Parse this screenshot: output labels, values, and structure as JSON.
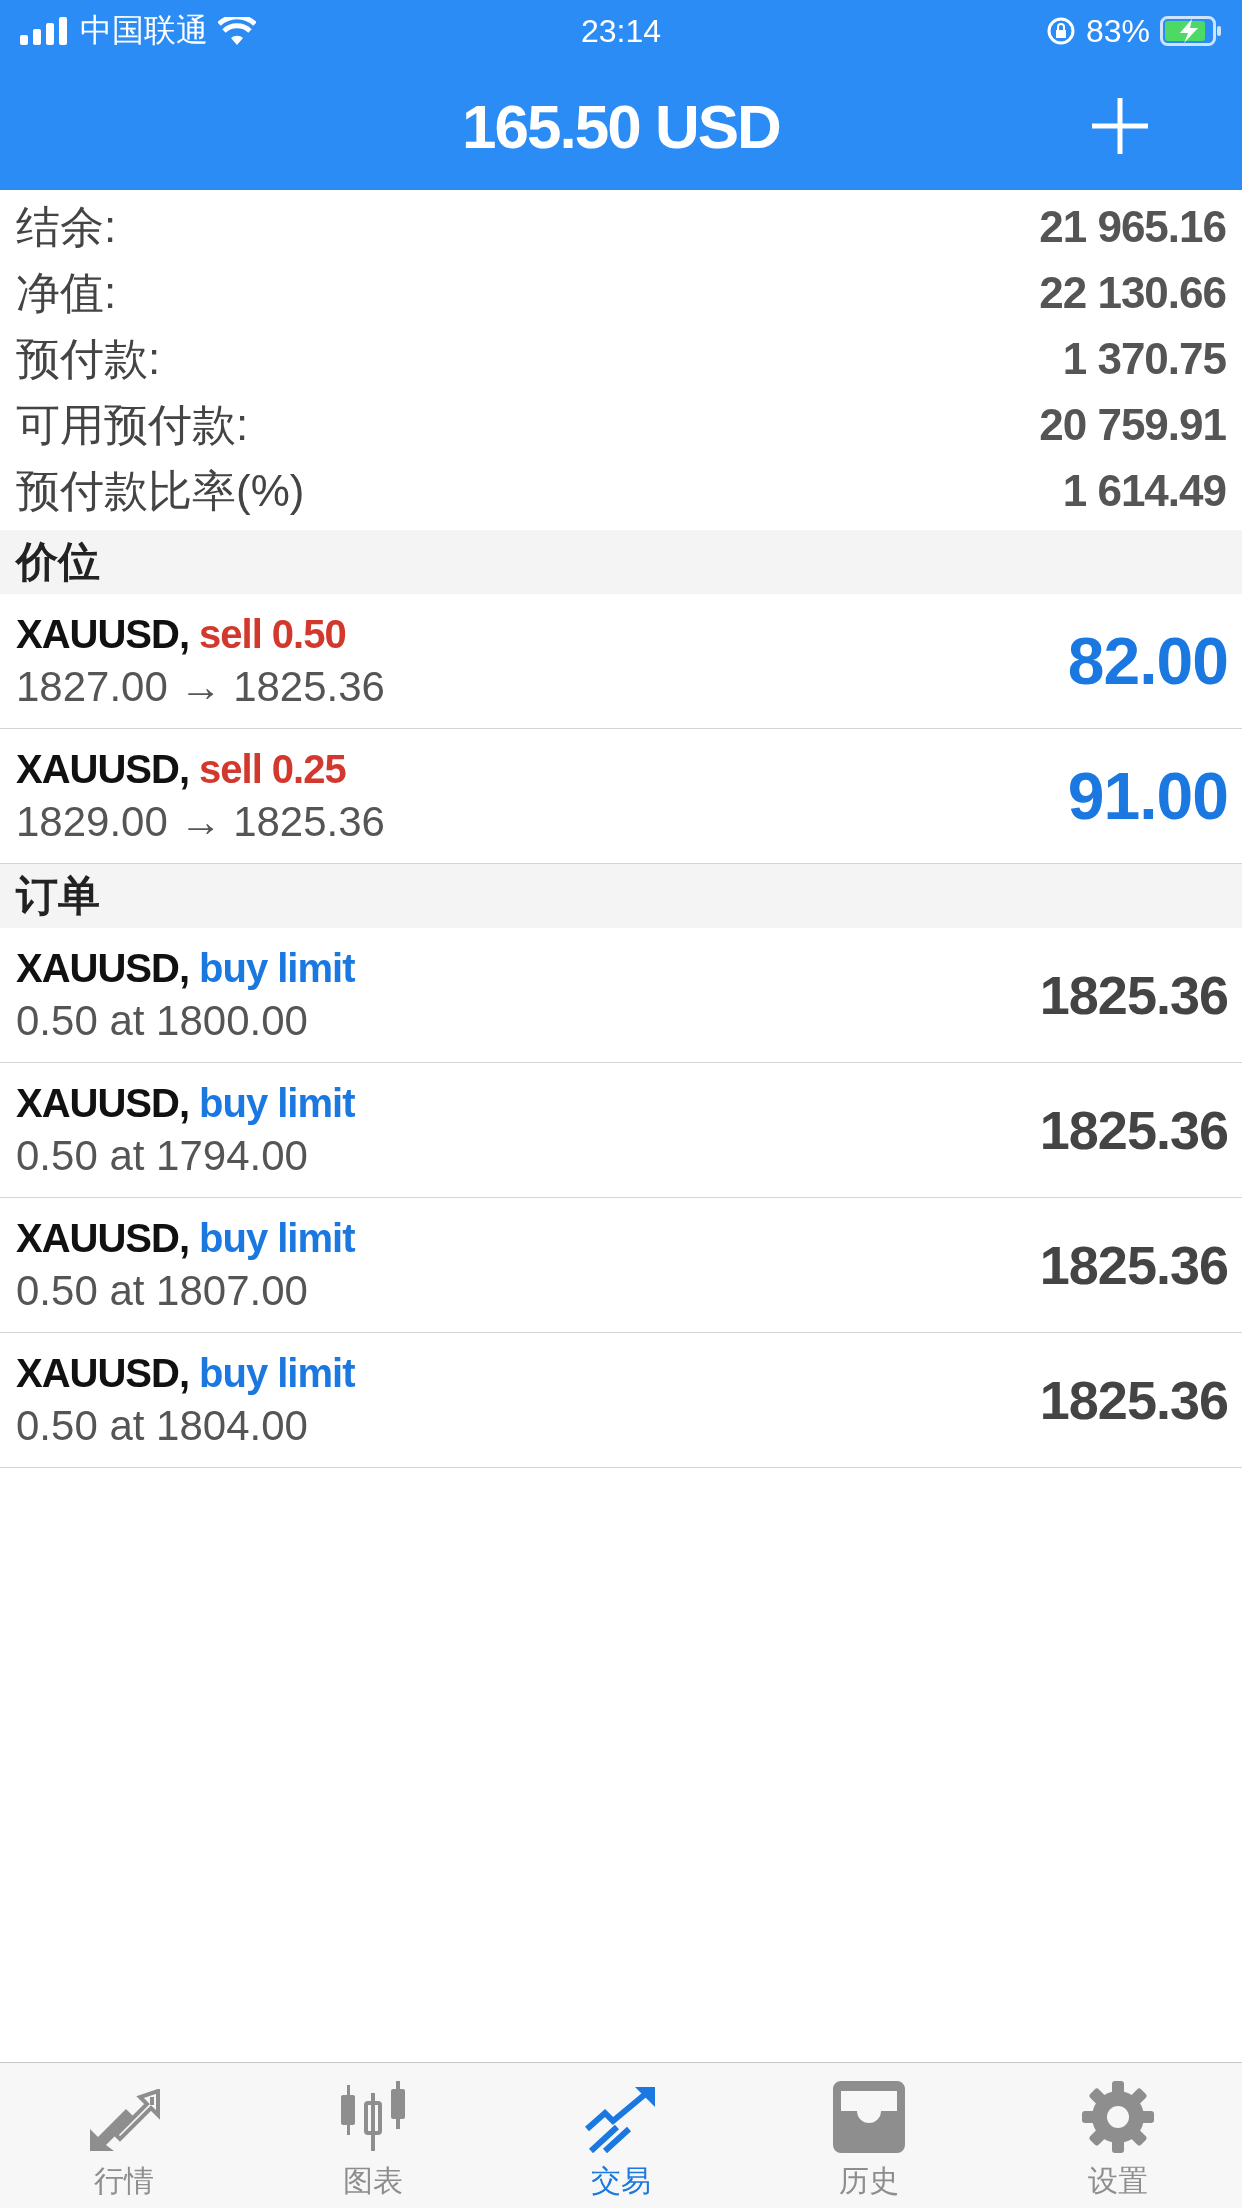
{
  "status_bar": {
    "carrier": "中国联通",
    "time": "23:14",
    "battery": "83%"
  },
  "header": {
    "title": "165.50 USD"
  },
  "summary": [
    {
      "label": "结余:",
      "value": "21 965.16"
    },
    {
      "label": "净值:",
      "value": "22 130.66"
    },
    {
      "label": "预付款:",
      "value": "1 370.75"
    },
    {
      "label": "可用预付款:",
      "value": "20 759.91"
    },
    {
      "label": "预付款比率(%)",
      "value": "1 614.49"
    }
  ],
  "sections": [
    {
      "title": "价位",
      "kind": "positions",
      "items": [
        {
          "symbol": "XAUUSD,",
          "kind": "sell",
          "type": "sell 0.50",
          "detail": "1827.00 → 1825.36",
          "amount": "82.00"
        },
        {
          "symbol": "XAUUSD,",
          "kind": "sell",
          "type": "sell 0.25",
          "detail": "1829.00 → 1825.36",
          "amount": "91.00"
        }
      ]
    },
    {
      "title": "订单",
      "kind": "orders",
      "items": [
        {
          "symbol": "XAUUSD,",
          "kind": "buy",
          "type": "buy limit",
          "detail": "0.50 at 1800.00",
          "amount": "1825.36"
        },
        {
          "symbol": "XAUUSD,",
          "kind": "buy",
          "type": "buy limit",
          "detail": "0.50 at 1794.00",
          "amount": "1825.36"
        },
        {
          "symbol": "XAUUSD,",
          "kind": "buy",
          "type": "buy limit",
          "detail": "0.50 at 1807.00",
          "amount": "1825.36"
        },
        {
          "symbol": "XAUUSD,",
          "kind": "buy",
          "type": "buy limit",
          "detail": "0.50 at 1804.00",
          "amount": "1825.36"
        }
      ]
    }
  ],
  "tabs": [
    {
      "label": "行情",
      "kind": "quotes",
      "selected": false
    },
    {
      "label": "图表",
      "kind": "chart",
      "selected": false
    },
    {
      "label": "交易",
      "kind": "trade",
      "selected": true
    },
    {
      "label": "历史",
      "kind": "history",
      "selected": false
    },
    {
      "label": "设置",
      "kind": "settings",
      "selected": false
    }
  ]
}
